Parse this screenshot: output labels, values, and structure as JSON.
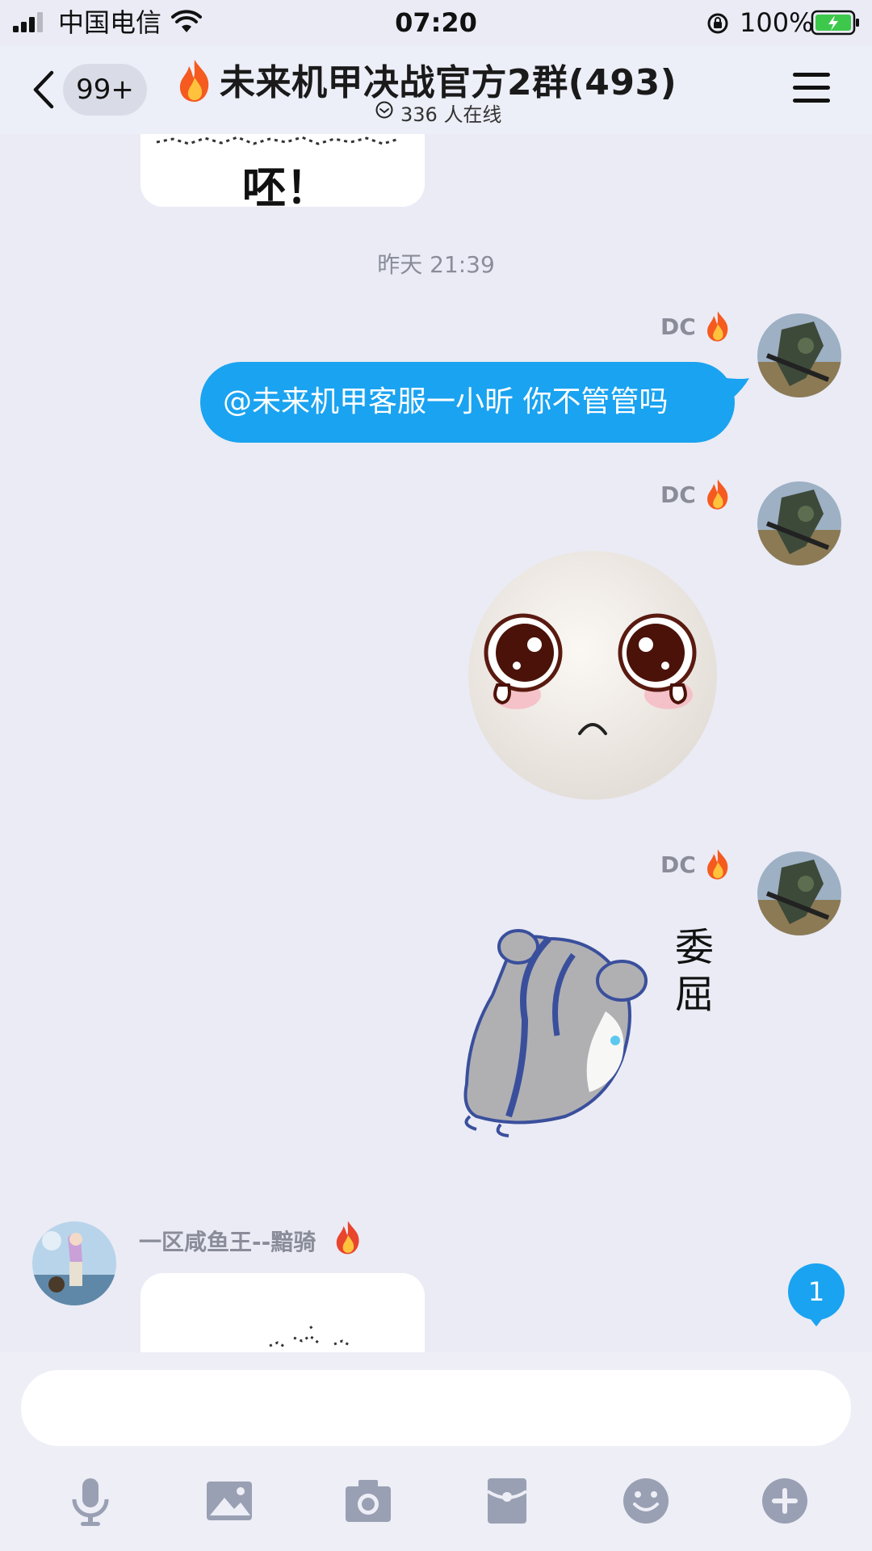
{
  "status_bar": {
    "carrier": "中国电信",
    "time": "07:20",
    "battery": "100%"
  },
  "header": {
    "back_badge": "99+",
    "title": "未来机甲决战官方2群(493)",
    "online": "336 人在线"
  },
  "chat": {
    "sticker_top_text": "呸！",
    "timestamp": "昨天 21:39",
    "messages": [
      {
        "nick": "DC",
        "text": "@未来机甲客服一小昕 你不管管吗"
      },
      {
        "nick": "DC"
      },
      {
        "nick": "DC",
        "sticker_caption": "委屈"
      },
      {
        "nick": "一区咸鱼王--黯骑"
      }
    ],
    "unread_count": "1"
  },
  "input": {
    "placeholder": ""
  },
  "colors": {
    "accent": "#1aa3f0",
    "background": "#eaebf5",
    "tool_icon": "#9aa0b3"
  }
}
